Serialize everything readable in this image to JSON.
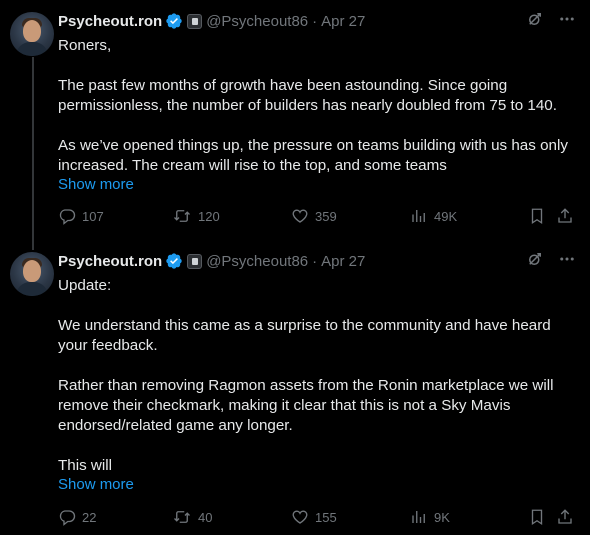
{
  "tweets": [
    {
      "name": "Psycheout.ron",
      "handle": "@Psycheout86",
      "separator": "·",
      "date": "Apr 27",
      "paragraphs": [
        "Roners,",
        "The past few months of growth have been astounding. Since going permissionless, the number of builders has nearly doubled from 75 to 140.",
        "As we’ve opened things up, the pressure on teams building with us has only increased. The cream will rise to the top, and some teams"
      ],
      "show_more": "Show more",
      "stats": {
        "replies": "107",
        "retweets": "120",
        "likes": "359",
        "views": "49K"
      }
    },
    {
      "name": "Psycheout.ron",
      "handle": "@Psycheout86",
      "separator": "·",
      "date": "Apr 27",
      "paragraphs": [
        "Update:",
        "We understand this came as a surprise to the community and have heard your feedback.",
        "Rather than removing Ragmon assets from the Ronin marketplace we will remove their checkmark, making it clear that this is not a Sky Mavis endorsed/related game any longer.",
        "This will"
      ],
      "show_more": "Show more",
      "stats": {
        "replies": "22",
        "retweets": "40",
        "likes": "155",
        "views": "9K"
      }
    }
  ],
  "icons": {
    "verified": "verified-badge-icon",
    "affiliate": "affiliate-badge-icon",
    "grok": "grok-icon",
    "more": "more-icon",
    "reply": "reply-icon",
    "retweet": "retweet-icon",
    "like": "like-icon",
    "views": "views-icon",
    "bookmark": "bookmark-icon",
    "share": "share-icon"
  },
  "colors": {
    "background": "#000000",
    "text": "#e7e9ea",
    "muted": "#71767b",
    "link": "#1d9bf0",
    "verified": "#1d9bf0"
  }
}
